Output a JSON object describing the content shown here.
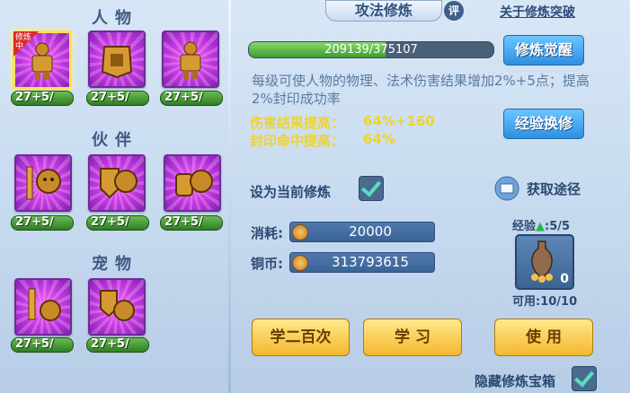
{
  "left_panel": {
    "sections": [
      {
        "title": "人物",
        "items": [
          {
            "icon": "armored-warrior-icon",
            "level": "27+5/",
            "selected": true,
            "badge": "修炼中"
          },
          {
            "icon": "armor-chest-icon",
            "level": "27+5/"
          },
          {
            "icon": "armored-warrior-icon",
            "level": "27+5/"
          }
        ]
      },
      {
        "title": "伙伴",
        "items": [
          {
            "icon": "sword-lion-icon",
            "level": "27+5/"
          },
          {
            "icon": "shield-lion-icon",
            "level": "27+5/"
          },
          {
            "icon": "gauntlet-lion-icon",
            "level": "27+5/"
          }
        ]
      },
      {
        "title": "宠物",
        "items": [
          {
            "icon": "sword-pet-icon",
            "level": "27+5/"
          },
          {
            "icon": "shield-pet-icon",
            "level": "27+5/"
          }
        ]
      }
    ]
  },
  "tab": {
    "title": "攻法修炼",
    "rating_icon": "评"
  },
  "breakthrough_link": "关于修炼突破",
  "progress": {
    "text": "209139/375107",
    "current": 209139,
    "max": 375107
  },
  "awaken_button": "修炼觉醒",
  "description": "每级可使人物的物理、法术伤害结果增加2%+5点；提高2%封印成功率",
  "stats": [
    {
      "label": "伤害结果提高：",
      "value": "64%+160"
    },
    {
      "label": "封印命中提高：",
      "value": "64%"
    }
  ],
  "exp_exchange_button": "经验换修",
  "set_current_label": "设为当前修炼",
  "obtain_link": "获取途径",
  "cost": {
    "label": "消耗:",
    "value": "20000"
  },
  "coins": {
    "label": "铜币:",
    "value": "313793615"
  },
  "exp_label": "经验",
  "exp_value": ":5/5",
  "vase_count": "0",
  "usable": "可用:10/10",
  "buttons": {
    "learn200": "学二百次",
    "learn": "学 习",
    "use": "使 用"
  },
  "hide_box_label": "隐藏修炼宝箱"
}
